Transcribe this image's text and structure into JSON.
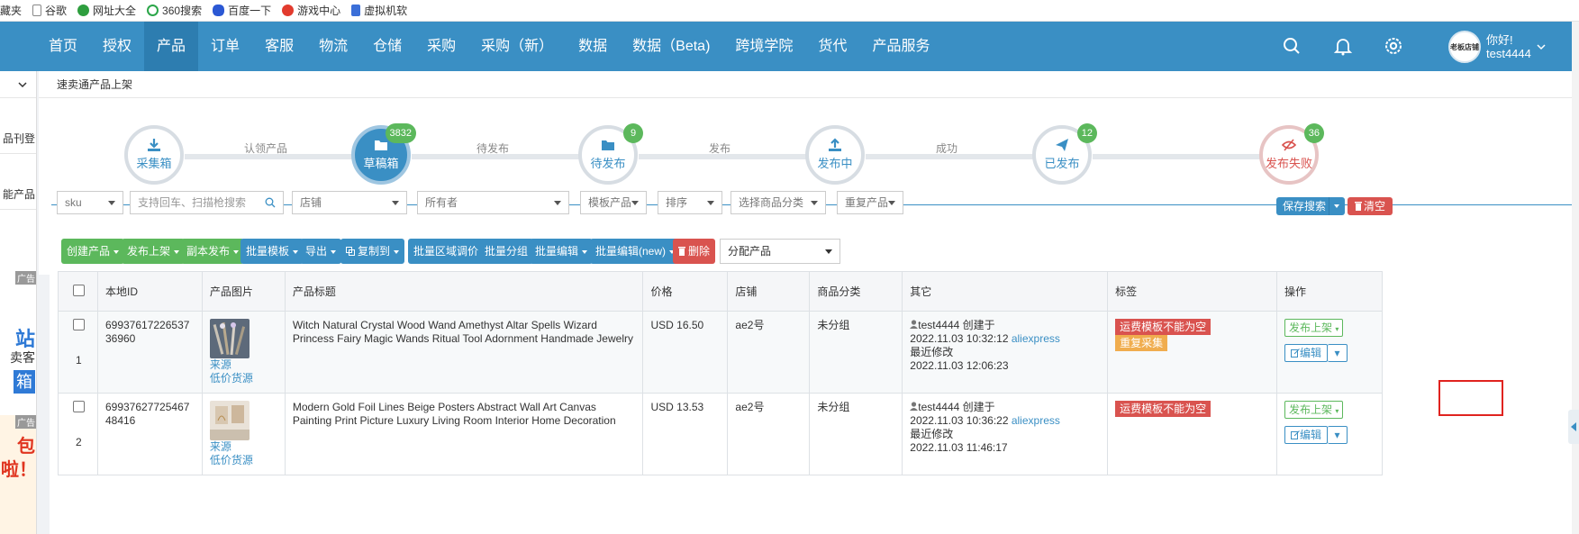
{
  "bookmarks": [
    {
      "label": "收藏夹",
      "icon": "star-icon"
    },
    {
      "label": "谷歌",
      "icon": "page-icon"
    },
    {
      "label": "网址大全",
      "icon": "globe-icon"
    },
    {
      "label": "360搜索",
      "icon": "search-360-icon"
    },
    {
      "label": "百度一下",
      "icon": "baidu-paw-icon"
    },
    {
      "label": "游戏中心",
      "icon": "game-icon"
    },
    {
      "label": "虚拟机软",
      "icon": "doc-icon"
    }
  ],
  "nav": {
    "items": [
      "首页",
      "授权",
      "产品",
      "订单",
      "客服",
      "物流",
      "仓储",
      "采购",
      "采购（新）",
      "数据",
      "数据（Beta)",
      "跨境学院",
      "货代",
      "产品服务"
    ],
    "active": "产品",
    "user_greeting": "你好!",
    "user_name": "test4444",
    "avatar_text": "老板店铺"
  },
  "left_panel": {
    "items": [
      "品刊登",
      "能产品",
      "广告",
      "站",
      "卖客",
      "箱",
      "广告",
      "包",
      "啦！"
    ]
  },
  "breadcrumb": "速卖通产品上架",
  "steps": [
    {
      "label": "采集箱",
      "icon": "download-icon",
      "count": null,
      "active": false
    },
    {
      "label": "草稿箱",
      "icon": "folder-icon",
      "count": "3832",
      "active": true
    },
    {
      "label": "待发布",
      "icon": "folder-icon",
      "count": "9",
      "active": false
    },
    {
      "label": "发布中",
      "icon": "upload-icon",
      "count": null,
      "active": false
    },
    {
      "label": "已发布",
      "icon": "send-icon",
      "count": "12",
      "active": false
    },
    {
      "label": "发布失败",
      "icon": "eye-slash-icon",
      "count": "36",
      "active": false
    }
  ],
  "step_connectors": [
    "认领产品",
    "待发布",
    "发布",
    "成功"
  ],
  "filters": {
    "sku": "sku",
    "search_placeholder": "支持回车、扫描枪搜索",
    "shop": "店铺",
    "owner": "所有者",
    "template": "模板产品",
    "sort": "排序",
    "category": "选择商品分类",
    "duplicate": "重复产品",
    "save_search": "保存搜索",
    "clear": "清空"
  },
  "toolbar": {
    "create": "创建产品",
    "publish": "发布上架",
    "copy_publish": "副本发布",
    "batch_template": "批量模板",
    "export": "导出",
    "copy_to": "复制到",
    "region_price": "批量区域调价",
    "batch_group": "批量分组",
    "batch_edit": "批量编辑",
    "batch_edit_new": "批量编辑(new)",
    "delete": "删除",
    "assign": "分配产品"
  },
  "table": {
    "headers": [
      "本地ID",
      "产品图片",
      "产品标题",
      "价格",
      "店铺",
      "商品分类",
      "其它",
      "标签",
      "操作"
    ],
    "rows": [
      {
        "index": "1",
        "local_id": "6993761722653736960",
        "source": "来源",
        "low_price": "低价货源",
        "title": "Witch Natural Crystal Wood Wand Amethyst Altar Spells Wizard Princess Fairy Magic Wands Ritual Tool Adornment Handmade Jewelry",
        "price": "USD 16.50",
        "shop": "ae2号",
        "category": "未分组",
        "creator": "test4444",
        "created_label": "创建于",
        "created": "2022.11.03 10:32:12",
        "platform": "aliexpress",
        "modified_label": "最近修改",
        "modified": "2022.11.03 12:06:23",
        "tags": [
          {
            "text": "运费模板不能为空",
            "color": "#d9534f"
          },
          {
            "text": "重复采集",
            "color": "#f0ad4e"
          }
        ],
        "publish_btn": "发布上架",
        "edit_btn": "编辑"
      },
      {
        "index": "2",
        "local_id": "6993762772546748416",
        "source": "来源",
        "low_price": "低价货源",
        "title": "Modern Gold Foil Lines Beige Posters Abstract Wall Art Canvas Painting Print Picture Luxury Living Room Interior Home Decoration",
        "price": "USD 13.53",
        "shop": "ae2号",
        "category": "未分组",
        "creator": "test4444",
        "created_label": "创建于",
        "created": "2022.11.03 10:36:22",
        "platform": "aliexpress",
        "modified_label": "最近修改",
        "modified": "2022.11.03 11:46:17",
        "tags": [
          {
            "text": "运费模板不能为空",
            "color": "#d9534f"
          }
        ],
        "publish_btn": "发布上架",
        "edit_btn": "编辑"
      }
    ]
  },
  "colors": {
    "primary": "#3a8fc4",
    "success": "#5cb85c",
    "danger": "#d9534f",
    "warning": "#f0ad4e"
  }
}
